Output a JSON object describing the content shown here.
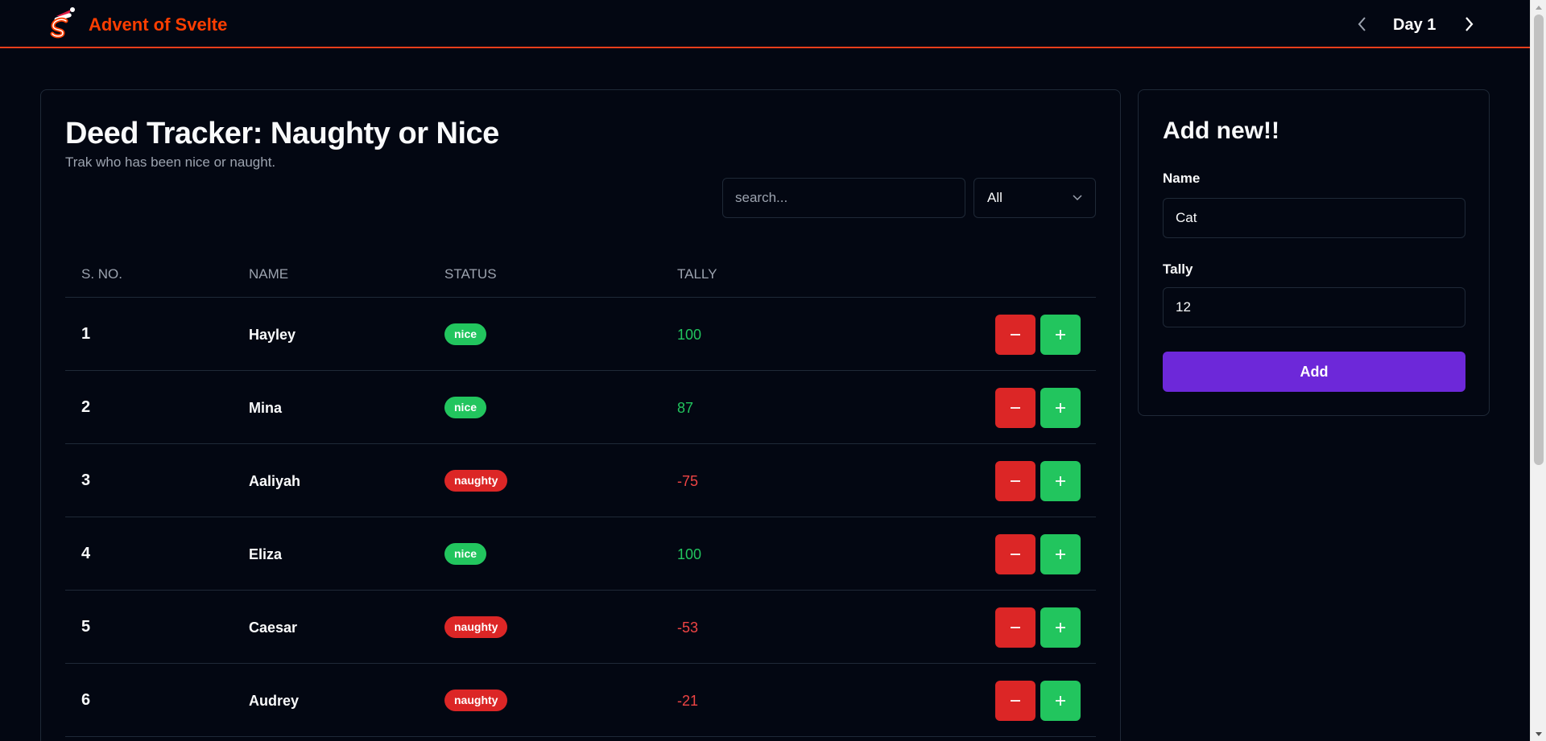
{
  "header": {
    "brand": "Advent of Svelte",
    "day_label": "Day 1",
    "prev_icon": "chevron-left-icon",
    "next_icon": "chevron-right-icon",
    "brand_color": "#ff3e00"
  },
  "main": {
    "title": "Deed Tracker: Naughty or Nice",
    "subtitle": "Trak who has been nice or naught.",
    "search": {
      "placeholder": "search..."
    },
    "filter": {
      "selected": "All"
    },
    "columns": [
      "S. NO.",
      "NAME",
      "STATUS",
      "TALLY"
    ],
    "rows": [
      {
        "sno": "1",
        "name": "Hayley",
        "status": "nice",
        "tally": "100"
      },
      {
        "sno": "2",
        "name": "Mina",
        "status": "nice",
        "tally": "87"
      },
      {
        "sno": "3",
        "name": "Aaliyah",
        "status": "naughty",
        "tally": "-75"
      },
      {
        "sno": "4",
        "name": "Eliza",
        "status": "nice",
        "tally": "100"
      },
      {
        "sno": "5",
        "name": "Caesar",
        "status": "naughty",
        "tally": "-53"
      },
      {
        "sno": "6",
        "name": "Audrey",
        "status": "naughty",
        "tally": "-21"
      }
    ]
  },
  "side": {
    "title": "Add new!!",
    "name_label": "Name",
    "name_value": "Cat",
    "tally_label": "Tally",
    "tally_value": "12",
    "add_label": "Add"
  },
  "colors": {
    "nice": "#22c55e",
    "naughty": "#dc2626",
    "accent": "#6d28d9",
    "background": "#030712"
  }
}
